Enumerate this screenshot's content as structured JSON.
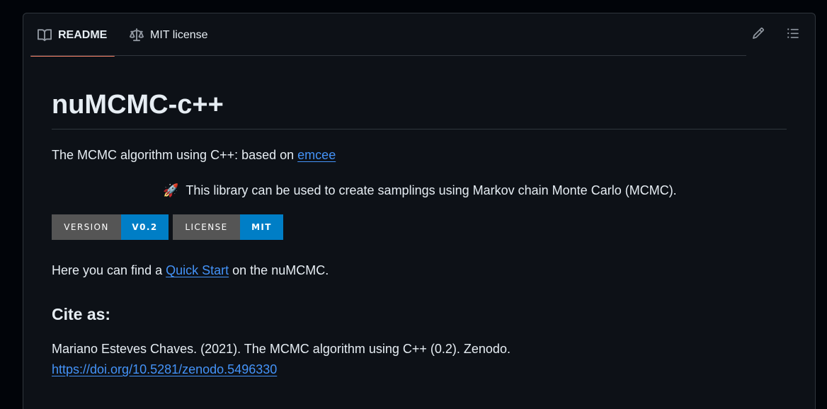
{
  "tabs": {
    "readme": "README",
    "license": "MIT license"
  },
  "readme": {
    "title": "nuMCMC-c++",
    "intro_prefix": "The MCMC algorithm using C++: based on ",
    "intro_link": "emcee",
    "tagline_emoji": "🚀",
    "tagline": "This library can be used to create samplings using Markov chain Monte Carlo (MCMC).",
    "badges": [
      {
        "label": "VERSION",
        "value": "V0.2",
        "color": "#007ec6"
      },
      {
        "label": "LICENSE",
        "value": "MIT",
        "color": "#007ec6"
      }
    ],
    "quickstart_prefix": "Here you can find a ",
    "quickstart_link": "Quick Start",
    "quickstart_suffix": " on the nuMCMC.",
    "cite_heading": "Cite as:",
    "citation": "Mariano Esteves Chaves. (2021). The MCMC algorithm using C++ (0.2). Zenodo.",
    "doi_link": "https://doi.org/10.5281/zenodo.5496330"
  }
}
